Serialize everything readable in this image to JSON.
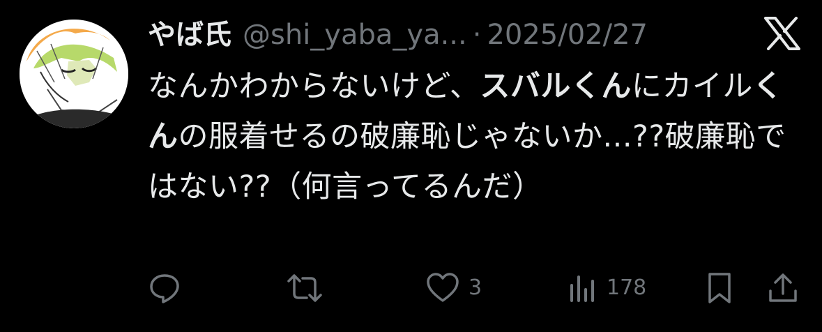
{
  "tweet": {
    "display_name": "やば氏",
    "handle": "@shi_yaba_ya...",
    "separator": "·",
    "date": "2025/02/27",
    "text": {
      "p1": "なんかわからないけど、",
      "b1": "スバルくん",
      "p2": "にカイル",
      "b2": "くん",
      "p3": "の服着せるの破廉恥じゃないか...??破廉恥ではない??（何言ってるんだ）"
    }
  },
  "actions": {
    "reply_icon": "reply-icon",
    "retweet_icon": "retweet-icon",
    "like_icon": "heart-icon",
    "like_count": "3",
    "views_icon": "views-icon",
    "views_count": "178",
    "bookmark_icon": "bookmark-icon",
    "share_icon": "share-icon"
  },
  "colors": {
    "background": "#000000",
    "primary_text": "#e7e9ea",
    "secondary_text": "#71767b"
  }
}
